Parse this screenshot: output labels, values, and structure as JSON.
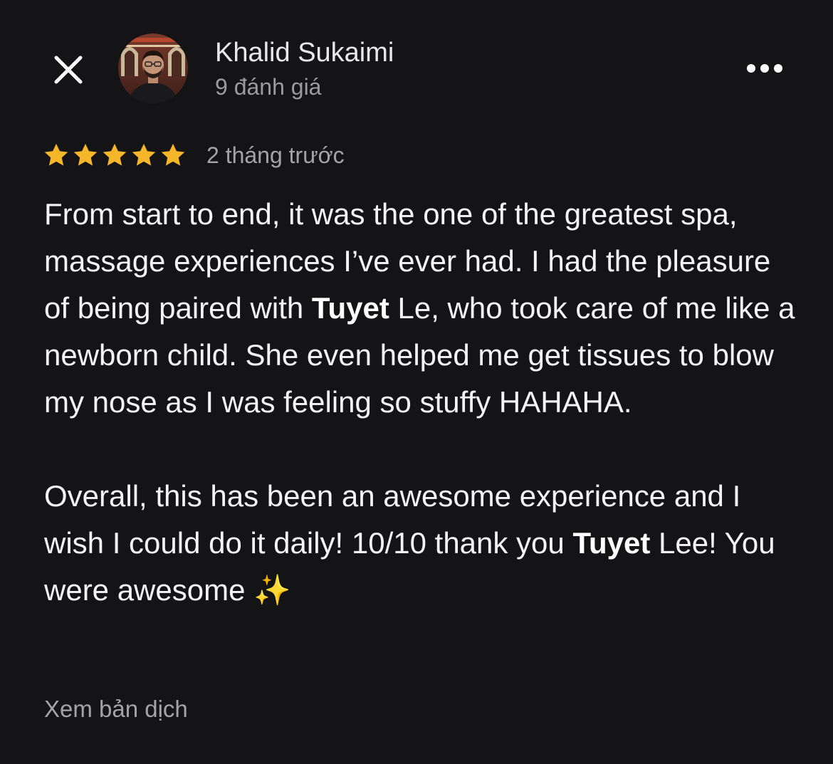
{
  "header": {
    "close_icon": "close-icon",
    "author_name": "Khalid Sukaimi",
    "review_count": "9 đánh giá",
    "more_icon": "more-horizontal-icon"
  },
  "rating": {
    "stars": 5,
    "max_stars": 5,
    "star_color": "#F6B629",
    "time_ago": "2 tháng trước"
  },
  "review": {
    "paragraph1": [
      "From start to end, it was the one of the greatest spa, massage experiences I’ve ever had. I had the pleasure of being paired with ",
      "Tuyet",
      " Le, who took care of me like a newborn child. She even helped me get tissues to blow my nose as I was feeling so stuffy HAHAHA."
    ],
    "paragraph2": [
      "Overall, this has been an awesome experience and I wish I could do it daily! 10/10 thank you ",
      "Tuyet",
      " Lee! You were awesome ",
      "✨"
    ]
  },
  "footer": {
    "translate_label": "Xem bản dịch"
  },
  "colors": {
    "background": "#141416",
    "primary_text": "#F4F4F6",
    "secondary_text": "#A3A3A8",
    "star": "#F6B629"
  }
}
